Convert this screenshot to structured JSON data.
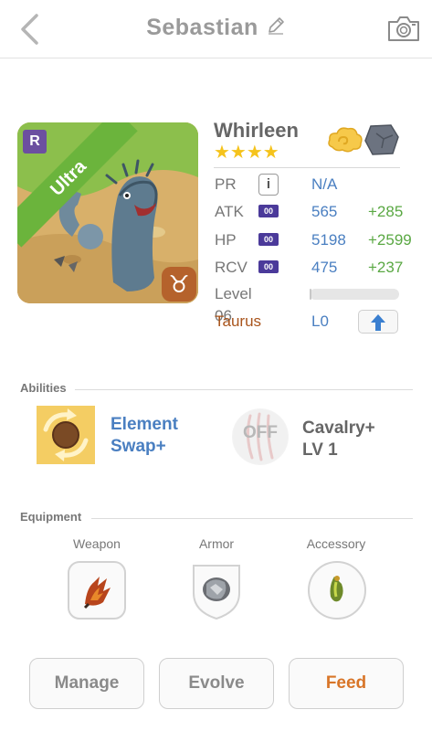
{
  "header": {
    "title": "Sebastian"
  },
  "monster": {
    "rarity_badge": "R",
    "ribbon": "Ultra",
    "zodiac_symbol": "♉",
    "name": "Whirleen",
    "stars": "★★★★",
    "element_icons": [
      "cloud-element-icon",
      "rock-element-icon"
    ]
  },
  "stats": {
    "pr": {
      "label": "PR",
      "value": "N/A"
    },
    "atk": {
      "label": "ATK",
      "badge": "00",
      "value": "565",
      "bonus": "+285"
    },
    "hp": {
      "label": "HP",
      "badge": "00",
      "value": "5198",
      "bonus": "+2599"
    },
    "rcv": {
      "label": "RCV",
      "badge": "00",
      "value": "475",
      "bonus": "+237"
    },
    "level": {
      "label": "Level 06",
      "progress": 0.02
    },
    "zodiac": {
      "label": "Taurus",
      "value": "L0"
    }
  },
  "abilities": {
    "section_label": "Abilities",
    "active": {
      "name_line1": "Element",
      "name_line2": "Swap+"
    },
    "leader": {
      "status": "OFF",
      "name_line1": "Cavalry+",
      "name_line2": "LV 1"
    }
  },
  "equipment": {
    "section_label": "Equipment",
    "slots": [
      {
        "label": "Weapon"
      },
      {
        "label": "Armor"
      },
      {
        "label": "Accessory"
      }
    ]
  },
  "actions": {
    "manage": "Manage",
    "evolve": "Evolve",
    "feed": "Feed"
  },
  "colors": {
    "accent_blue": "#4a7fc1",
    "bonus_green": "#5aa843",
    "feed_orange": "#d87528",
    "taurus_brown": "#a9541c",
    "ultra_green": "#6bb43c",
    "star_yellow": "#f5c31c"
  }
}
